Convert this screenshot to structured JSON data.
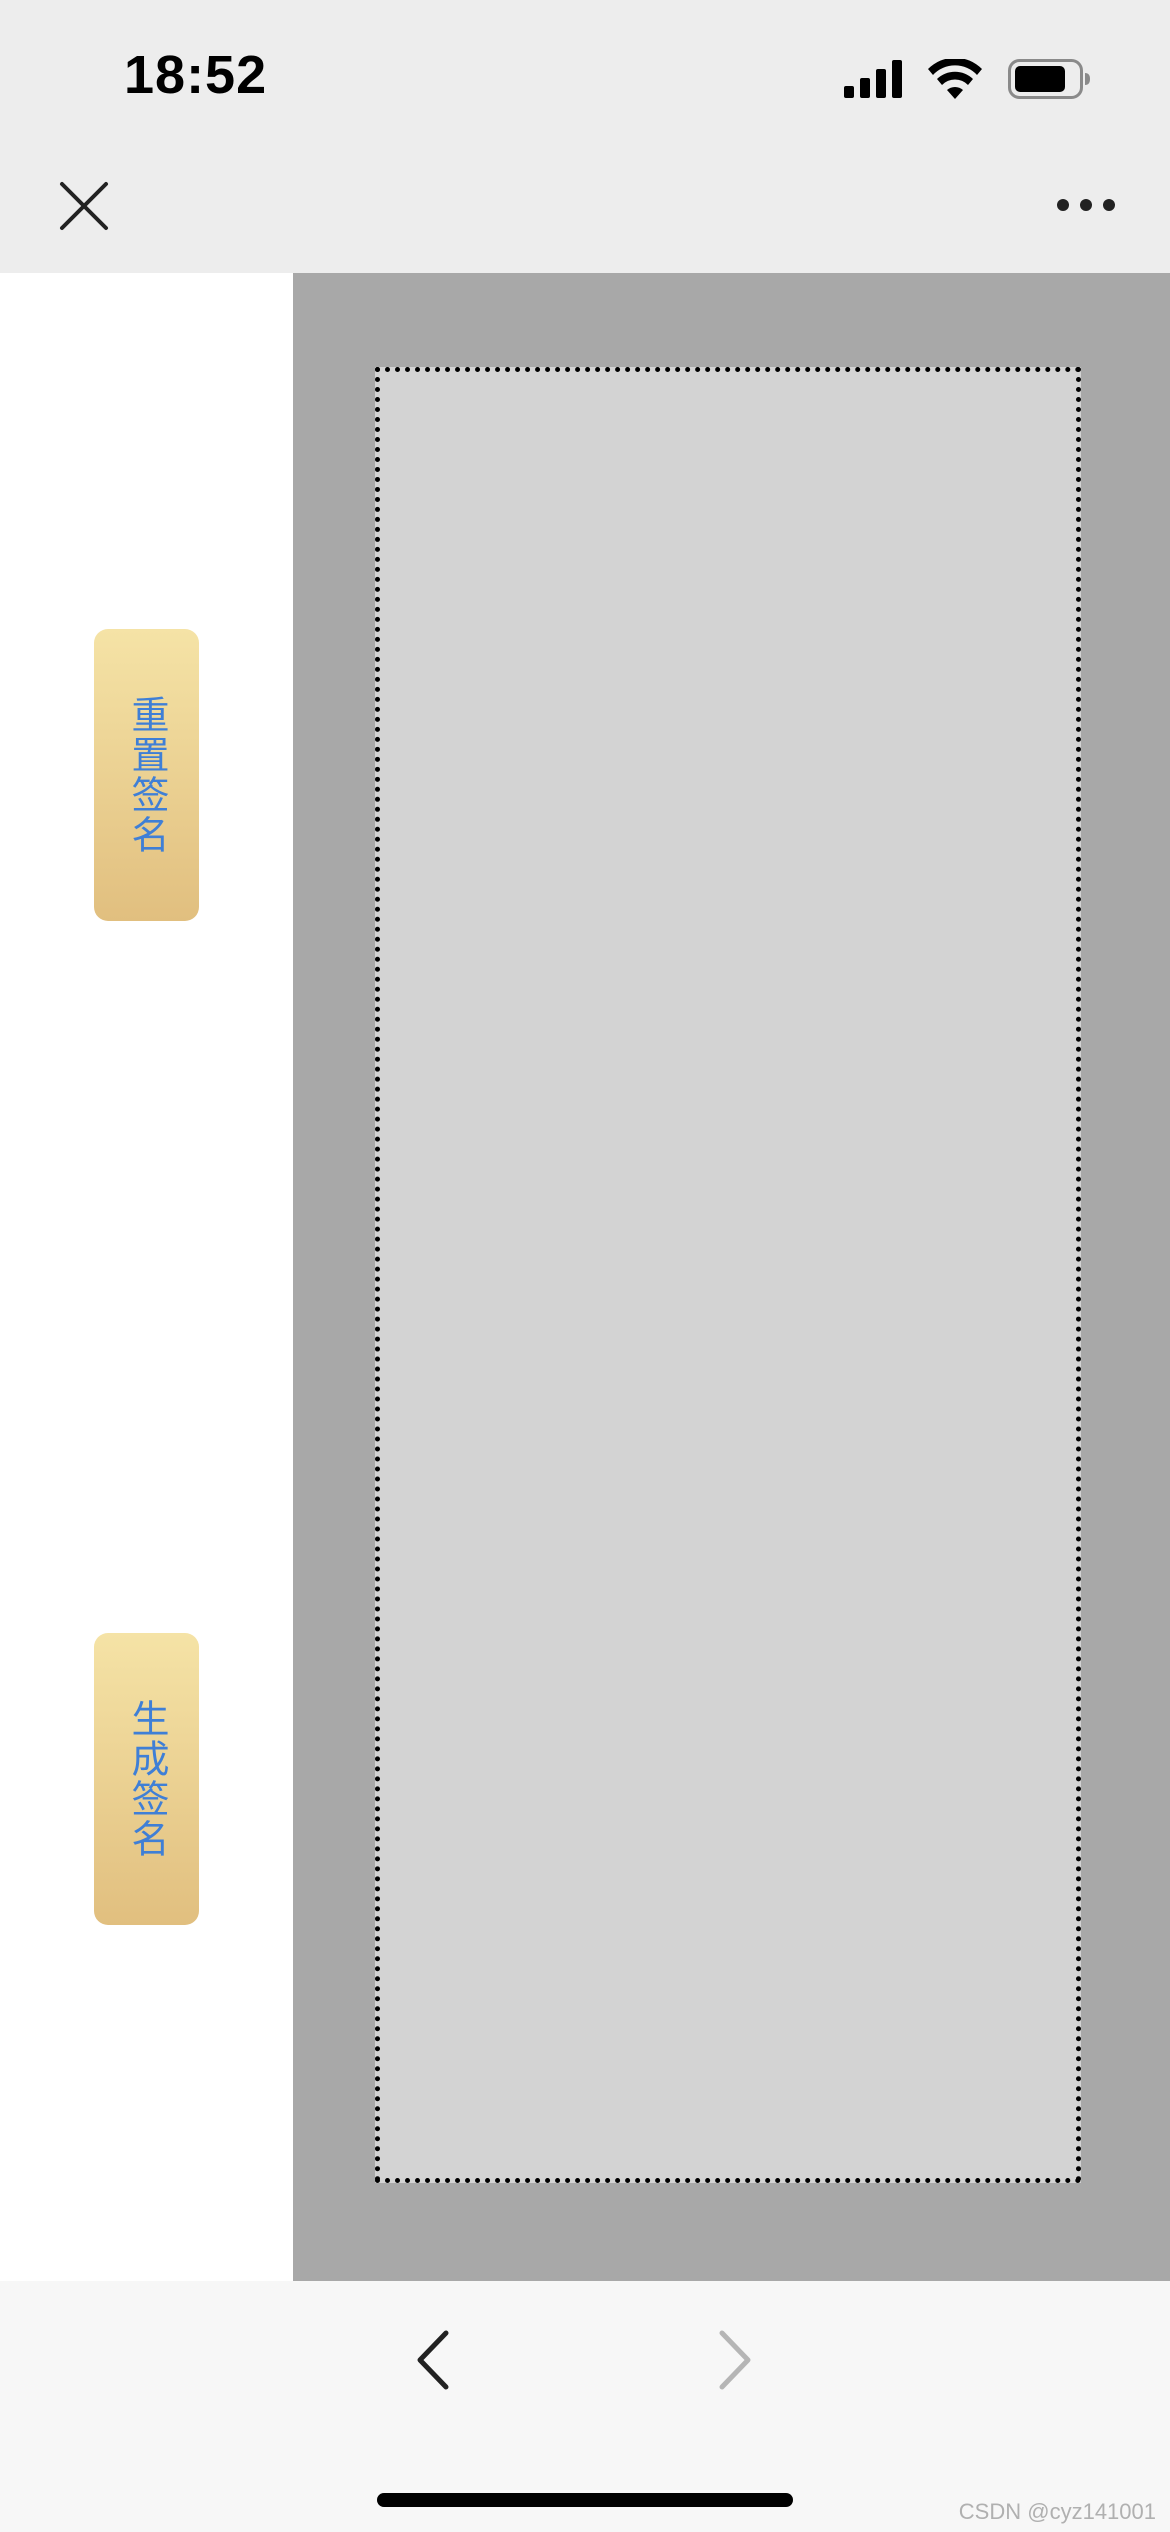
{
  "status_bar": {
    "time": "18:52",
    "icons": [
      "signal-icon",
      "wifi-icon",
      "battery-icon"
    ]
  },
  "nav_bar": {
    "close_icon": "close-icon",
    "more_icon": "more-icon"
  },
  "sidebar": {
    "reset_label": "重置签名",
    "generate_label": "生成签名"
  },
  "toolbar": {
    "back_icon": "chevron-left-icon",
    "forward_icon": "chevron-right-icon",
    "forward_enabled": false
  },
  "watermark": "CSDN @cyz141001",
  "colors": {
    "button_text": "#3f7fd6",
    "button_gradient_top": "#f5e3a6",
    "button_gradient_bottom": "#e1bf7f",
    "canvas_bg": "#a8a8a8",
    "pad_bg": "#d3d3d3"
  }
}
